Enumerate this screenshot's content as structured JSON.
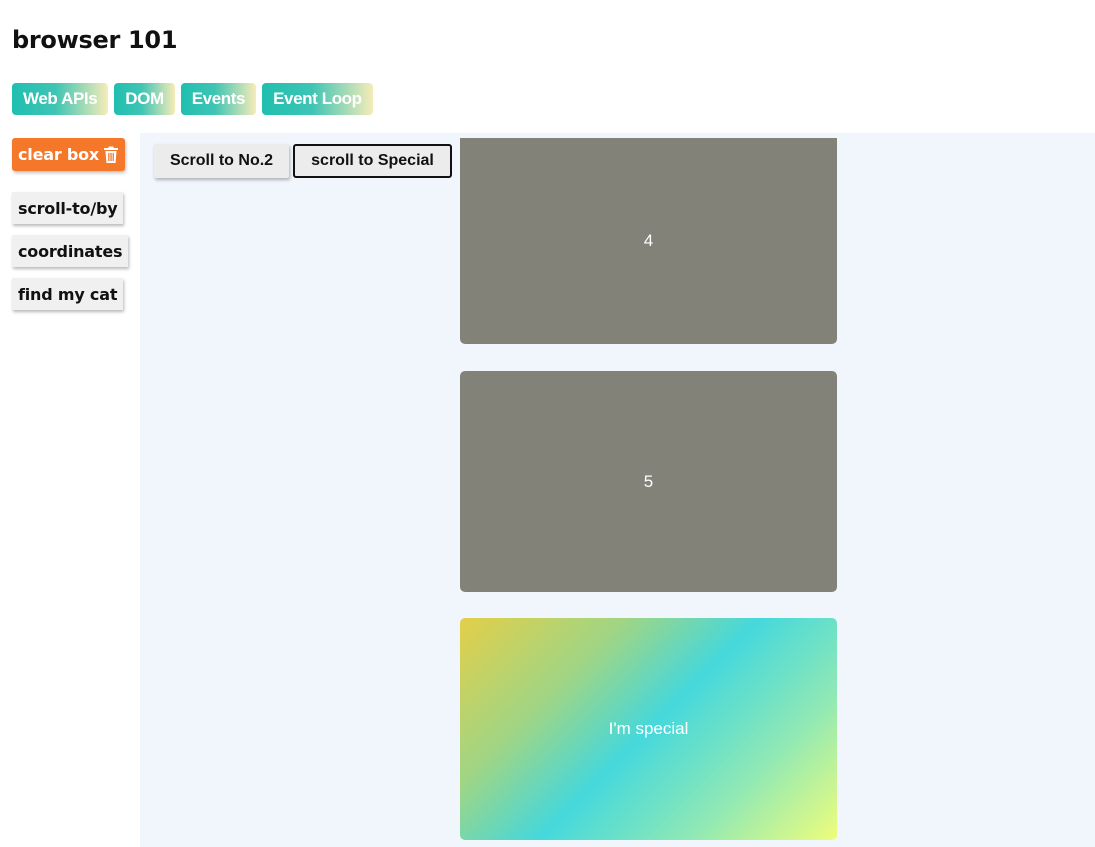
{
  "page": {
    "title": "browser 101"
  },
  "nav": {
    "tabs": [
      {
        "label": "Web APIs"
      },
      {
        "label": "DOM"
      },
      {
        "label": "Events"
      },
      {
        "label": "Event Loop"
      }
    ]
  },
  "sidebar": {
    "clear_label": "clear box",
    "clear_icon": "trash-icon",
    "items": [
      {
        "label": "scroll-to/by"
      },
      {
        "label": "coordinates"
      },
      {
        "label": "find my cat"
      }
    ]
  },
  "main": {
    "buttons": {
      "scroll_no2": "Scroll to No.2",
      "scroll_special": "scroll to Special"
    },
    "boxes": [
      {
        "label": "4"
      },
      {
        "label": "5"
      },
      {
        "label": "I'm special"
      }
    ]
  },
  "colors": {
    "clear_button": "#f5782a",
    "gray_box": "#838279",
    "panel_bg": "#f1f5fc",
    "nav_gradient_start": "#1fbfb0",
    "nav_gradient_end": "#f6ecb8"
  }
}
